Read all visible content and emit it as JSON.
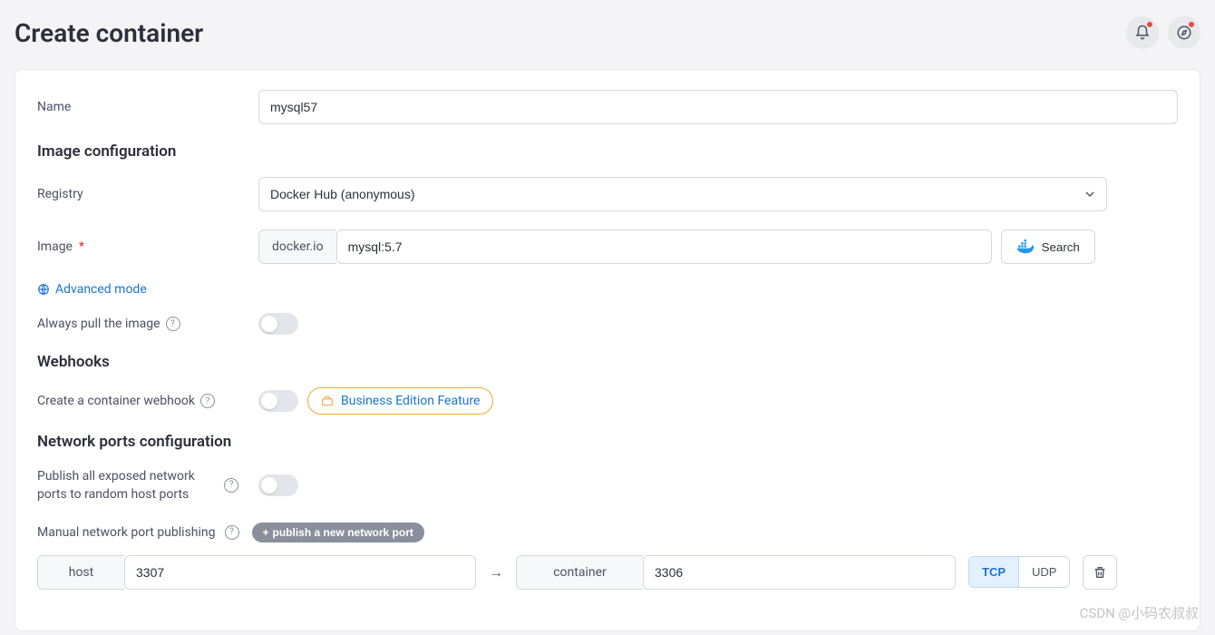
{
  "header": {
    "title": "Create container"
  },
  "form": {
    "name": {
      "label": "Name",
      "value": "mysql57"
    },
    "image_config": {
      "section": "Image configuration",
      "registry": {
        "label": "Registry",
        "selected": "Docker Hub (anonymous)"
      },
      "image": {
        "label": "Image",
        "prefix": "docker.io",
        "value": "mysql:5.7"
      },
      "search_btn": "Search",
      "advanced_link": "Advanced mode",
      "always_pull": {
        "label": "Always pull the image"
      }
    },
    "webhooks": {
      "section": "Webhooks",
      "create_label": "Create a container webhook",
      "badge": "Business Edition Feature"
    },
    "network": {
      "section": "Network ports configuration",
      "publish_all": "Publish all exposed network ports to random host ports",
      "manual_label": "Manual network port publishing",
      "publish_btn": "publish a new network port",
      "port": {
        "host_label": "host",
        "host_value": "3307",
        "container_label": "container",
        "container_value": "3306",
        "tcp": "TCP",
        "udp": "UDP"
      }
    }
  },
  "watermark": "CSDN @小码农叔叔"
}
